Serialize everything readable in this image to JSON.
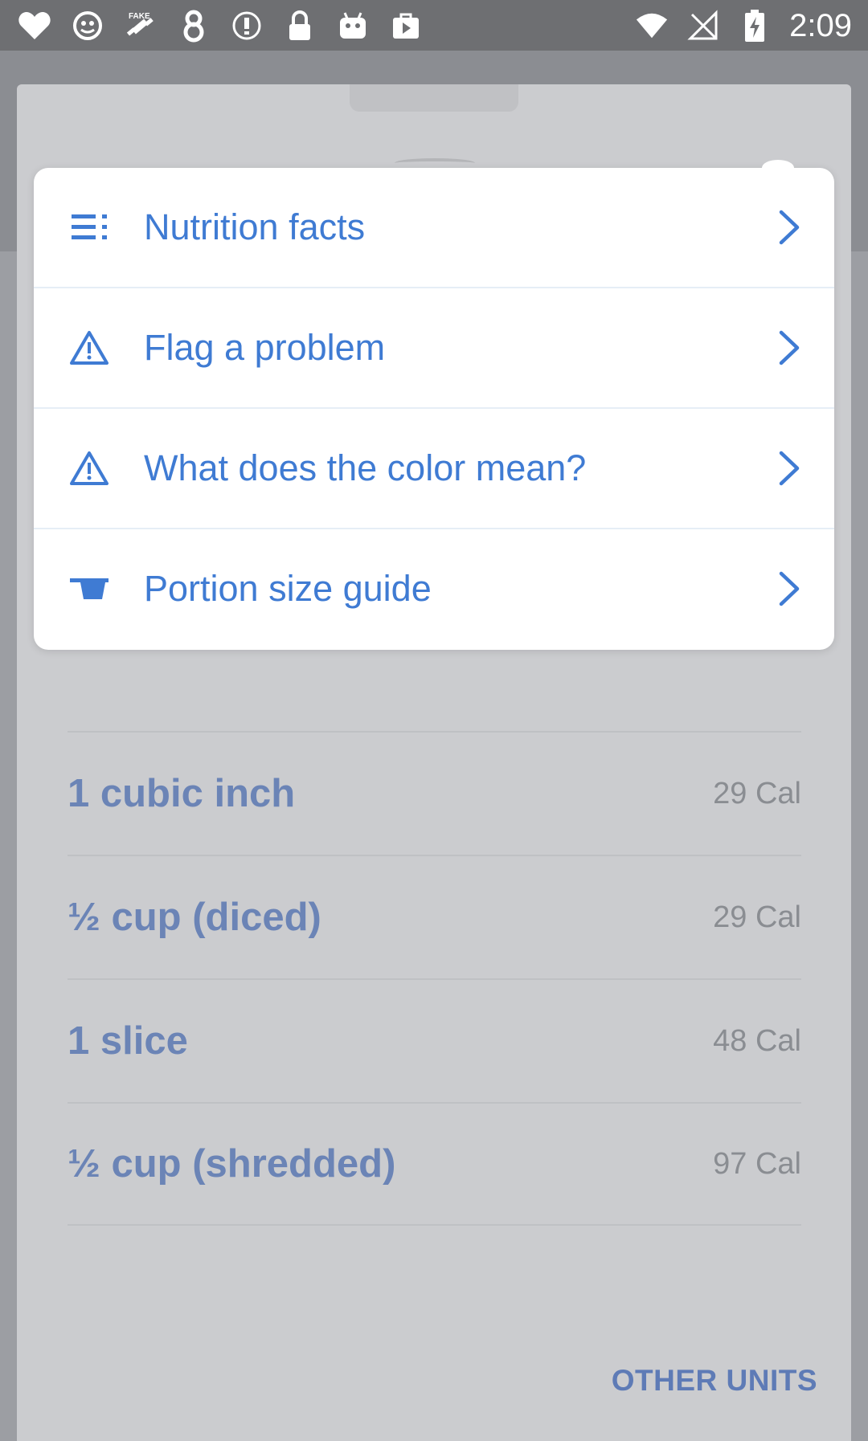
{
  "status_bar": {
    "time": "2:09",
    "left_icons": [
      "heart-icon",
      "android-alien-icon",
      "fake-gps-icon",
      "number-8-icon",
      "info-circle-icon",
      "lock-icon",
      "android-icon",
      "play-bag-icon"
    ],
    "right_icons": [
      "wifi-icon",
      "no-signal-icon",
      "battery-charging-icon"
    ]
  },
  "menu": {
    "items": [
      {
        "label": "Nutrition facts",
        "icon": "list-icon"
      },
      {
        "label": "Flag a problem",
        "icon": "warning-icon"
      },
      {
        "label": "What does the color mean?",
        "icon": "warning-icon"
      },
      {
        "label": "Portion size guide",
        "icon": "bowl-icon"
      }
    ]
  },
  "portions": [
    {
      "label": "1 cubic inch",
      "calories": "29 Cal"
    },
    {
      "label": "½ cup (diced)",
      "calories": "29 Cal"
    },
    {
      "label": "1 slice",
      "calories": "48 Cal"
    },
    {
      "label": "½ cup (shredded)",
      "calories": "97 Cal"
    }
  ],
  "other_units_label": "OTHER UNITS",
  "colors": {
    "accent": "#3f7bd3",
    "status_bar": "#6e6f72",
    "dim_sheet": "#cbcccf"
  }
}
